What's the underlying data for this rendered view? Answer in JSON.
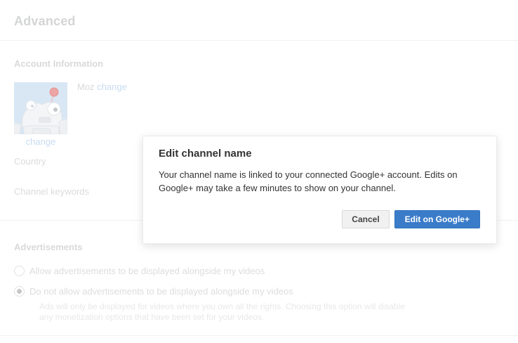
{
  "page": {
    "title": "Advanced",
    "account_information": {
      "heading": "Account Information",
      "channel_name": "Moz",
      "change_name_link": "change",
      "change_avatar_link": "change",
      "country_label": "Country",
      "channel_keywords_label": "Channel keywords"
    },
    "advertisements": {
      "heading": "Advertisements",
      "options": [
        {
          "label": "Allow advertisements to be displayed alongside my videos",
          "selected": false
        },
        {
          "label": "Do not allow advertisements to be displayed alongside my videos",
          "selected": true
        }
      ],
      "help_text": "Ads will only be displayed for videos where you own all the rights. Choosing this option will disable any monetization options that have been set for your videos."
    }
  },
  "dialog": {
    "title": "Edit channel name",
    "body": "Your channel name is linked to your connected Google+ account. Edits on Google+ may take a few minutes to show on your channel.",
    "cancel_label": "Cancel",
    "confirm_label": "Edit on Google+"
  },
  "icons": {
    "avatar": "moz-robot-avatar"
  },
  "colors": {
    "primary_button": "#3b7cc9",
    "dimmed_link": "#c8dcf1",
    "dimmed_text": "#d8d9da",
    "modal_background": "#ffffff"
  }
}
